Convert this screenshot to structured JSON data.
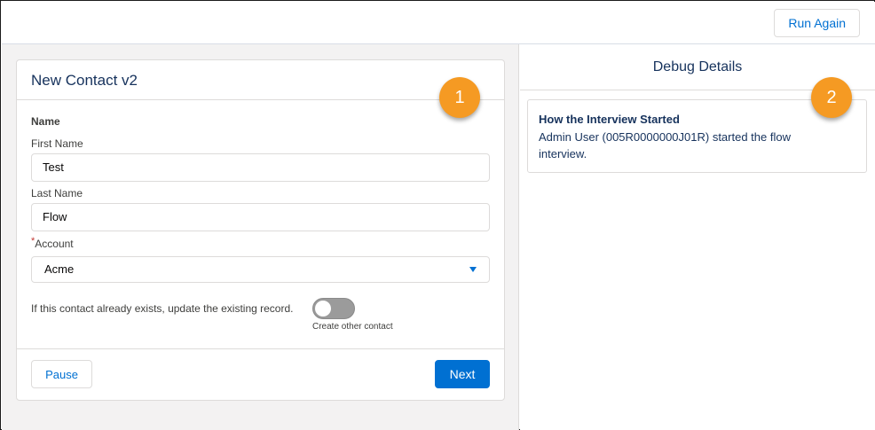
{
  "toolbar": {
    "run_again_label": "Run Again"
  },
  "screen": {
    "title": "New Contact v2",
    "section_label": "Name",
    "first_name": {
      "label": "First Name",
      "value": "Test"
    },
    "last_name": {
      "label": "Last Name",
      "value": "Flow"
    },
    "account": {
      "label": "Account",
      "required_marker": "*",
      "selected": "Acme"
    },
    "update_toggle": {
      "label": "If this contact already exists, update the existing record.",
      "caption": "Create other contact",
      "on": false
    },
    "pause_label": "Pause",
    "next_label": "Next"
  },
  "debug": {
    "header": "Debug Details",
    "entry_title": "How the Interview Started",
    "entry_text": "Admin User (005R0000000J01R) started the flow interview."
  },
  "callouts": {
    "badge_1": "1",
    "badge_2": "2"
  },
  "colors": {
    "brand": "#0070d2",
    "badge": "#f59a23",
    "heading": "#16325c",
    "required": "#c23934"
  }
}
